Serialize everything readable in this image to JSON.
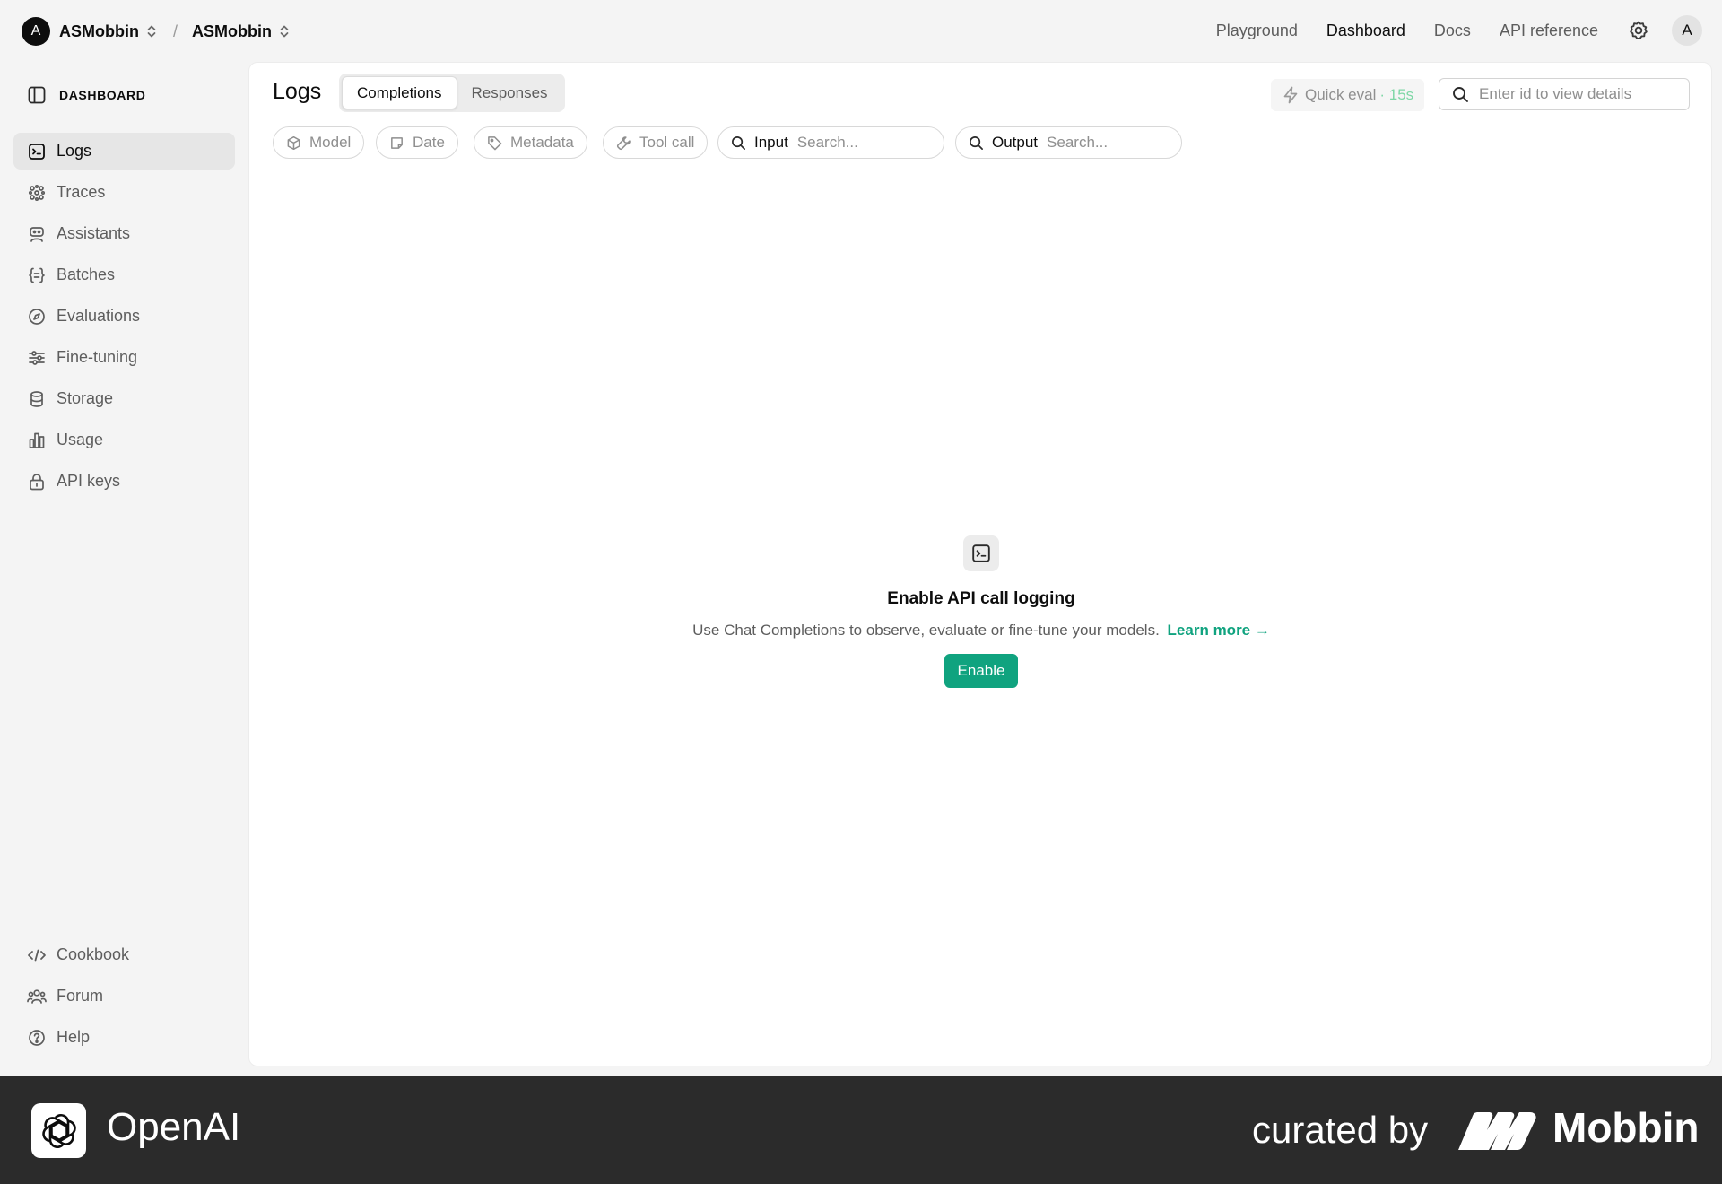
{
  "topbar": {
    "org_initial": "A",
    "org_name": "ASMobbin",
    "separator": "/",
    "project_name": "ASMobbin",
    "nav": [
      "Playground",
      "Dashboard",
      "Docs",
      "API reference"
    ],
    "active_nav": "Dashboard",
    "user_initial": "A"
  },
  "sidebar": {
    "header": "DASHBOARD",
    "items": [
      {
        "label": "Logs",
        "icon": "terminal-icon",
        "active": true
      },
      {
        "label": "Traces",
        "icon": "traces-icon"
      },
      {
        "label": "Assistants",
        "icon": "robot-icon"
      },
      {
        "label": "Batches",
        "icon": "braces-icon"
      },
      {
        "label": "Evaluations",
        "icon": "compass-icon"
      },
      {
        "label": "Fine-tuning",
        "icon": "sliders-icon"
      },
      {
        "label": "Storage",
        "icon": "database-icon"
      },
      {
        "label": "Usage",
        "icon": "bar-chart-icon"
      },
      {
        "label": "API keys",
        "icon": "lock-icon"
      }
    ],
    "bottom_items": [
      {
        "label": "Cookbook",
        "icon": "code-icon"
      },
      {
        "label": "Forum",
        "icon": "people-icon"
      },
      {
        "label": "Help",
        "icon": "help-icon"
      }
    ]
  },
  "main": {
    "title": "Logs",
    "tabs": [
      "Completions",
      "Responses"
    ],
    "active_tab": "Completions",
    "quick_eval": {
      "label": "Quick eval",
      "timer": "· 15s"
    },
    "id_search_placeholder": "Enter id to view details",
    "filters": {
      "model": "Model",
      "date": "Date",
      "metadata": "Metadata",
      "tool_call": "Tool call",
      "input_label": "Input",
      "input_placeholder": "Search...",
      "output_label": "Output",
      "output_placeholder": "Search..."
    },
    "empty_state": {
      "title": "Enable API call logging",
      "description": "Use Chat Completions to observe, evaluate or fine-tune your models.",
      "link": "Learn more →",
      "button": "Enable"
    }
  },
  "footer": {
    "brand": "OpenAI",
    "curated_by": "curated by",
    "curator": "Mobbin"
  },
  "colors": {
    "accent": "#10a37f",
    "timer": "#7fd7a6",
    "footer_bg": "#2b2b2b"
  }
}
